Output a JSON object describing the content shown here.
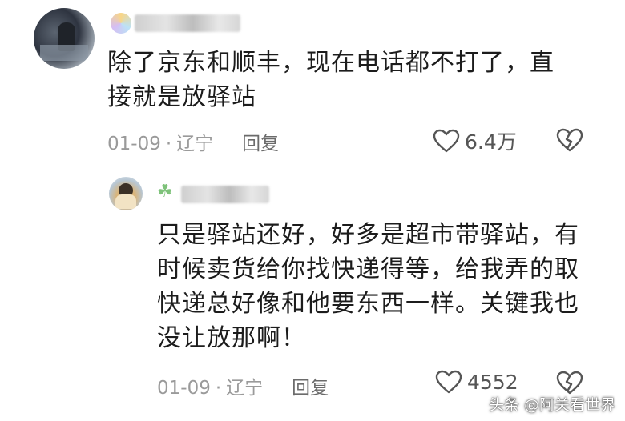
{
  "comments": [
    {
      "text_line1": "除了京东和顺丰，现在电话都不打了，直",
      "text_line2": "接就是放驿站",
      "date": "01-09",
      "separator": "·",
      "location": "辽宁",
      "reply_label": "回复",
      "likes": "6.4万"
    },
    {
      "text_line1": "只是驿站还好，好多是超市带驿站，有",
      "text_line2": "时候卖货给你找快递得等，给我弄的取",
      "text_line3": "快递总好像和他要东西一样。关键我也",
      "text_line4": "没让放那啊！",
      "date": "01-09",
      "separator": "·",
      "location": "辽宁",
      "reply_label": "回复",
      "likes": "4552"
    }
  ],
  "watermark": "头条 @阿关看世界",
  "icons": {
    "like": "heart-outline-icon",
    "dislike": "broken-heart-icon",
    "badge_reply": "clover-icon"
  },
  "colors": {
    "text": "#1c1c1c",
    "meta": "#9a9a9a",
    "icon": "#555555"
  }
}
